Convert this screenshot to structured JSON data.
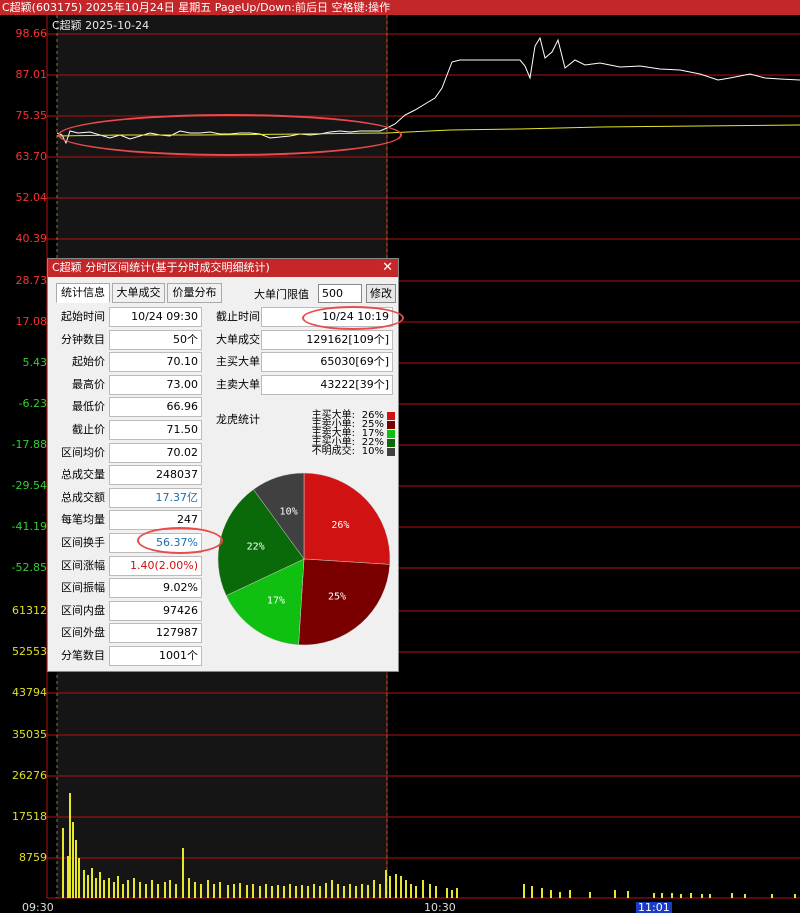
{
  "window": {
    "title": "C超颖(603175)  2025年10月24日  星期五  PageUp/Down:前后日  空格键:操作",
    "stock_label": "C超颖    2025-10-24"
  },
  "y_axis": [
    {
      "label": "98.66",
      "color": "#ff3030"
    },
    {
      "label": "87.01",
      "color": "#ff3030"
    },
    {
      "label": "75.35",
      "color": "#ff3030"
    },
    {
      "label": "63.70",
      "color": "#ff3030"
    },
    {
      "label": "52.04",
      "color": "#ff3030"
    },
    {
      "label": "40.39",
      "color": "#ff3030"
    },
    {
      "label": "28.73",
      "color": "#ff3030"
    },
    {
      "label": "17.08",
      "color": "#ff3030"
    },
    {
      "label": "5.43",
      "color": "#30d030"
    },
    {
      "label": "-6.23",
      "color": "#30d030"
    },
    {
      "label": "-17.88",
      "color": "#30d030"
    },
    {
      "label": "-29.54",
      "color": "#30d030"
    },
    {
      "label": "-41.19",
      "color": "#30d030"
    },
    {
      "label": "-52.85",
      "color": "#30d030"
    },
    {
      "label": "61312",
      "color": "#e0e020"
    },
    {
      "label": "52553",
      "color": "#e0e020"
    },
    {
      "label": "43794",
      "color": "#e0e020"
    },
    {
      "label": "35035",
      "color": "#e0e020"
    },
    {
      "label": "26276",
      "color": "#e0e020"
    },
    {
      "label": "17518",
      "color": "#e0e020"
    },
    {
      "label": "8759",
      "color": "#e0e020"
    }
  ],
  "x_axis": [
    "09:30",
    "10:30",
    "11:01"
  ],
  "colors": {
    "background": "#000000",
    "grid_red": "#b01414",
    "price_line": "#ffffff",
    "avg_line": "#e6e62a",
    "volume_bar": "#e6e62a",
    "annotation": "#e84b4b",
    "titlebar": "#c4272a"
  },
  "dialog": {
    "title": "C超颖 分时区间统计(基于分时成交明细统计)",
    "close_icon": "close-icon",
    "tabs": [
      "统计信息",
      "大单成交",
      "价量分布"
    ],
    "active_tab": 0,
    "threshold_label": "大单门限值",
    "threshold_value": "500",
    "modify_label": "修改",
    "stats": [
      {
        "label": "起始时间",
        "value": "10/24 09:30",
        "style": ""
      },
      {
        "label": "分钟数目",
        "value": "50个",
        "style": ""
      },
      {
        "label": "起始价",
        "value": "70.10",
        "style": ""
      },
      {
        "label": "最高价",
        "value": "73.00",
        "style": ""
      },
      {
        "label": "最低价",
        "value": "66.96",
        "style": ""
      },
      {
        "label": "截止价",
        "value": "71.50",
        "style": ""
      },
      {
        "label": "区间均价",
        "value": "70.02",
        "style": ""
      },
      {
        "label": "总成交量",
        "value": "248037",
        "style": ""
      },
      {
        "label": "总成交额",
        "value": "17.37亿",
        "style": "blue"
      },
      {
        "label": "每笔均量",
        "value": "247",
        "style": ""
      },
      {
        "label": "区间换手",
        "value": "56.37%",
        "style": "blue"
      },
      {
        "label": "区间涨幅",
        "value": "1.40(2.00%)",
        "style": "red"
      },
      {
        "label": "区间振幅",
        "value": "9.02%",
        "style": ""
      },
      {
        "label": "区间内盘",
        "value": "97426",
        "style": ""
      },
      {
        "label": "区间外盘",
        "value": "127987",
        "style": ""
      },
      {
        "label": "分笔数目",
        "value": "1001个",
        "style": ""
      }
    ],
    "stats_right": [
      {
        "label": "截止时间",
        "value": "10/24 10:19"
      },
      {
        "label": "大单成交",
        "value": "129162[109个]"
      },
      {
        "label": "主买大单",
        "value": "65030[69个]"
      },
      {
        "label": "主卖大单",
        "value": "43222[39个]"
      }
    ],
    "dragon_title": "龙虎统计"
  },
  "chart_data": {
    "type": "pie",
    "title": "龙虎统计",
    "slices": [
      {
        "name": "主买大单",
        "value": 26,
        "label": "26%",
        "color": "#d01212"
      },
      {
        "name": "主卖大单",
        "value": 25,
        "label": "25%",
        "color": "#7a0000"
      },
      {
        "name": "主买小单",
        "value": 17,
        "label": "17%",
        "color": "#10c010"
      },
      {
        "name": "主卖小单",
        "value": 22,
        "label": "22%",
        "color": "#0a6a0a"
      },
      {
        "name": "不明成交",
        "value": 10,
        "label": "10%",
        "color": "#404040"
      }
    ],
    "legend_order": [
      {
        "name": "主买大单",
        "label": "26%",
        "color": "#d01212"
      },
      {
        "name": "主卖小单",
        "label": "25%",
        "color": "#7a0000"
      },
      {
        "name": "主卖大单",
        "label": "17%",
        "color": "#10c010"
      },
      {
        "name": "主买小单",
        "label": "22%",
        "color": "#0a6a0a"
      },
      {
        "name": "不明成交",
        "label": "10%",
        "color": "#404040"
      }
    ]
  }
}
